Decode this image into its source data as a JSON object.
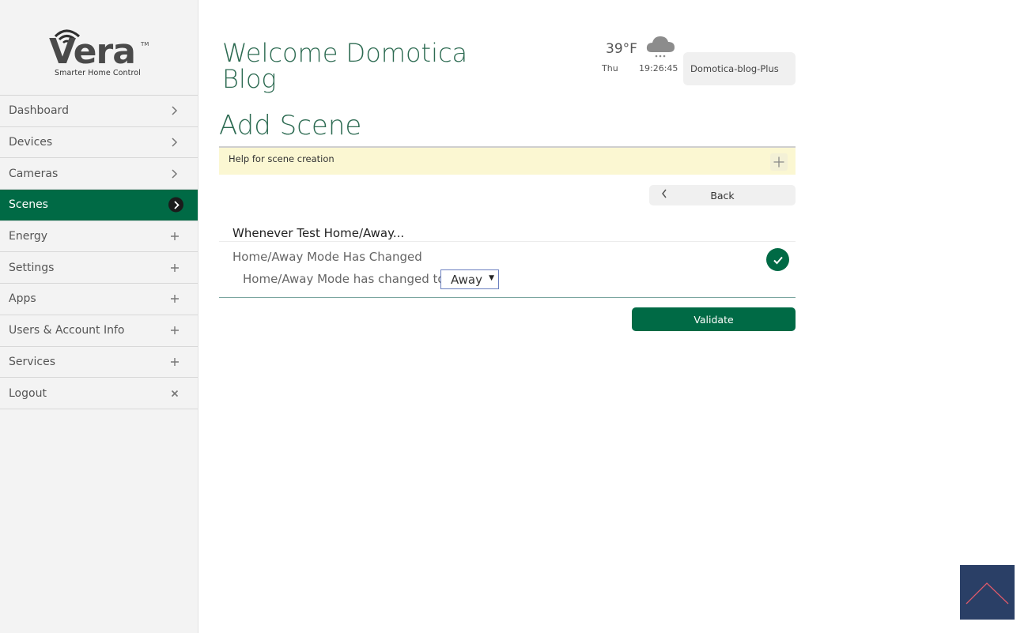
{
  "logo": {
    "word": "Vera",
    "trademark": "TM",
    "tagline": "Smarter Home Control"
  },
  "nav": {
    "items": [
      {
        "label": "Dashboard",
        "indicator": "chevron-right-icon"
      },
      {
        "label": "Devices",
        "indicator": "chevron-right-icon"
      },
      {
        "label": "Cameras",
        "indicator": "chevron-right-icon"
      },
      {
        "label": "Scenes",
        "indicator": "chevron-right-icon",
        "active": true
      },
      {
        "label": "Energy",
        "indicator": "plus-icon"
      },
      {
        "label": "Settings",
        "indicator": "plus-icon"
      },
      {
        "label": "Apps",
        "indicator": "plus-icon"
      },
      {
        "label": "Users & Account Info",
        "indicator": "plus-icon"
      },
      {
        "label": "Services",
        "indicator": "plus-icon"
      },
      {
        "label": "Logout",
        "indicator": "close-icon"
      }
    ]
  },
  "header": {
    "welcome": "Welcome Domotica Blog",
    "weather": {
      "temperature": "39°F",
      "day": "Thu",
      "time": "19:26:45",
      "icon": "snow-cloud-icon"
    },
    "account": "Domotica-blog-Plus"
  },
  "page": {
    "title": "Add Scene",
    "help_text": "Help for scene creation",
    "back_label": "Back",
    "trigger_heading": "Whenever Test Home/Away...",
    "trigger_title": "Home/Away Mode Has Changed",
    "condition_label": "Home/Away Mode has changed to:",
    "mode_select": {
      "selected": "Away"
    },
    "validate_label": "Validate"
  },
  "colors": {
    "brand_green": "#006a45",
    "title_green": "#2d6b52",
    "help_bg": "#fbf7d2",
    "scroll_top_bg": "#2a3f66"
  }
}
